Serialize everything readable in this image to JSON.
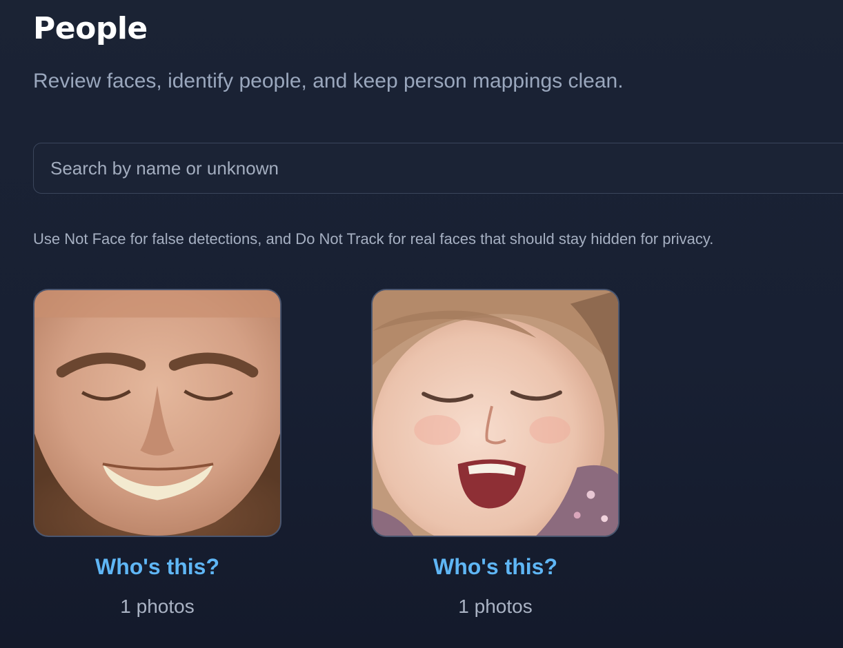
{
  "header": {
    "title": "People",
    "subtitle": "Review faces, identify people, and keep person mappings clean."
  },
  "search": {
    "placeholder": "Search by name or unknown",
    "value": ""
  },
  "hint": "Use Not Face for false detections, and Do Not Track for real faces that should stay hidden for privacy.",
  "people": [
    {
      "name": "Who's this?",
      "count": "1 photos",
      "thumbnail": "bearded-man-face"
    },
    {
      "name": "Who's this?",
      "count": "1 photos",
      "thumbnail": "toddler-girl-face"
    }
  ],
  "colors": {
    "background": "#1a2233",
    "accent": "#5fb6f5",
    "title": "#ffffff",
    "muted": "#9aa7bd"
  }
}
